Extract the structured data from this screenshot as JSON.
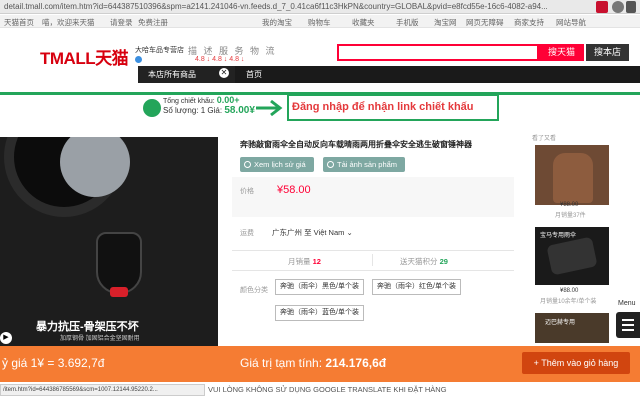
{
  "browser": {
    "url": "detail.tmall.com/item.htm?id=644387510396&spm=a2141.241046-vn.feeds.d_7_0.41ca6f11c3HkPN&country=GLOBAL&pvid=e8fcd55e-16c6-4082-a94..."
  },
  "topnav": {
    "items": [
      "天猫首页",
      "喵，欢迎来天猫",
      "请登录",
      "免费注册",
      "我的淘宝",
      "购物车",
      "收藏夹",
      "手机版",
      "淘宝网",
      "网页无障碍",
      "商家支持",
      "网站导航"
    ]
  },
  "header": {
    "logo": "TMALL天猫",
    "shop_name": "大哈车品专营店",
    "ratings_label": "描 述 服 务 物 流",
    "ratings": "4.8 ↓  4.8 ↓  4.8 ↓",
    "search_tmall": "搜天猫",
    "search_shop": "搜本店"
  },
  "catbar": {
    "all": "本店所有商品",
    "close": "✕",
    "home": "首页"
  },
  "promo": {
    "line1_prefix": "Tổng chiết khấu:",
    "line1_value": "0.00+",
    "line2_prefix": "Số lượng: 1  Giá:",
    "line2_value": "58.00¥",
    "login_text": "Đăng nhập để nhận link chiết khấu"
  },
  "product": {
    "title": "奔驰敲窗雨伞全自动反向车载晴雨两用折叠伞安全逃生破窗锤神器",
    "history_button": "Xem lịch sử giá",
    "image_button": "Tải ảnh sản phẩm",
    "price_label": "价格",
    "price": "¥58.00",
    "ship_label": "运费",
    "ship_value": "广东广州 至 Việt Nam",
    "monthly_sales_label": "月销量",
    "monthly_sales_value": "12",
    "points_label": "送天猫积分",
    "points_value": "29",
    "color_label": "颜色分类",
    "options": [
      "奔驰（雨伞）黑色/单个装",
      "奔驰（雨伞）红色/单个装",
      "奔驰（雨伞）蓝色/单个装"
    ],
    "caption": "暴力抗压-骨架压不坏",
    "caption_sub": "加厚钢骨 加固铝合金坚固耐用",
    "play_icon": "▶"
  },
  "sidebar": {
    "heading": "看了又看",
    "item1_price": "¥88.00",
    "item1_sold": "月销量37件",
    "item2_label": "宝马专用雨伞",
    "item2_price": "¥88.00",
    "item2_sold": "月销量10余年/单个装",
    "item3_label": "迈巴赫专用",
    "menu_label": "Menu"
  },
  "bottombar": {
    "rate": "ỷ giá 1¥ = 3.692,7đ",
    "total_prefix": "Giá trị tạm tính:",
    "total_value": "214.176,6đ",
    "add_to_cart": "+ Thêm vào giỏ hàng"
  },
  "status": {
    "url": "/item.htm?id=644386785569&scm=1007.12144.95220.2...",
    "warning": "VUI LÒNG KHÔNG SỬ DỤNG GOOGLE TRANSLATE KHI ĐẶT HÀNG"
  },
  "colors": {
    "tmall_red": "#ff0036",
    "promo_green": "#23a55a",
    "bottom_orange": "#f57c33",
    "history_button": "#7ea8a2"
  }
}
